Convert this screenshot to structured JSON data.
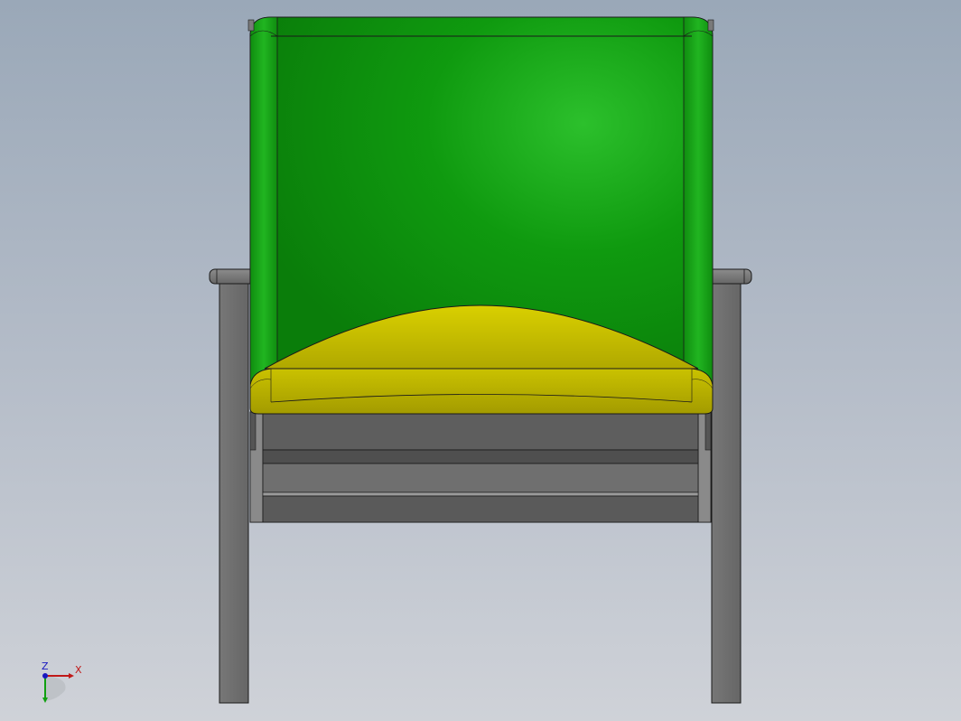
{
  "viewport": {
    "background_top": "#9aa8b8",
    "background_bottom": "#cfd2d8"
  },
  "model": {
    "name": "armchair",
    "parts": [
      "seat-back",
      "seat-cushion",
      "armrest-left",
      "armrest-right",
      "leg-left",
      "leg-right",
      "seat-frame"
    ],
    "colors": {
      "backrest": "#12a012",
      "backrest_highlight": "#2bbf2b",
      "cushion": "#c8c000",
      "frame": "#6f6f6f",
      "frame_light": "#8a8a8a",
      "outline": "#1a1a1a"
    }
  },
  "triad": {
    "x_label": "X",
    "z_label": "Z",
    "x_color": "#c01818",
    "y_color": "#10a010",
    "z_color": "#1818c0"
  }
}
